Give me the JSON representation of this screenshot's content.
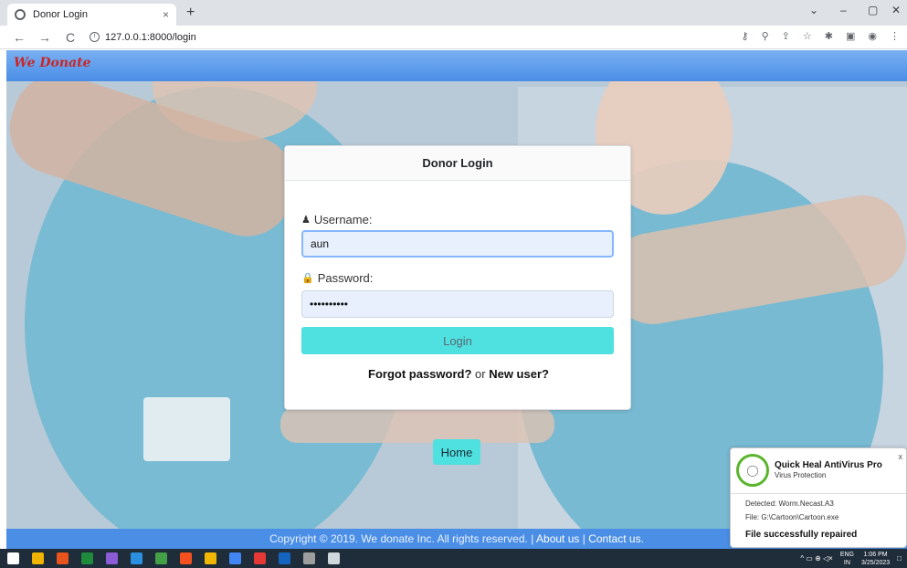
{
  "browser": {
    "tab_title": "Donor Login",
    "tab_close": "×",
    "new_tab": "+",
    "url": "127.0.0.1:8000/login",
    "nav": {
      "back": "←",
      "forward": "→",
      "reload": "C"
    },
    "window_controls": {
      "chevron": "⌄",
      "minimize": "–",
      "restore": "▢",
      "close": "✕"
    },
    "toolbar_icons": [
      "⚷",
      "⚲",
      "⇪",
      "☆",
      "✱",
      "▣",
      "◉",
      "⋮"
    ]
  },
  "navbar": {
    "brand": "We Donate"
  },
  "login": {
    "heading": "Donor Login",
    "username_label": "Username:",
    "username_value": "aun",
    "password_label": "Password:",
    "password_value": "••••••••••",
    "login_button": "Login",
    "forgot": "Forgot password?",
    "or": "or",
    "new_user": "New user?"
  },
  "home_button": "Home",
  "footer": {
    "copyright": "Copyright © 2019. We donate Inc. All rights reserved.",
    "sep": "|",
    "about": "About us",
    "contact": "Contact us."
  },
  "antivirus": {
    "title": "Quick Heal AntiVirus Pro",
    "subtitle": "Virus Protection",
    "detected": "Detected: Worm.Necast.A3",
    "file": "File: G:\\Cartoon\\Cartoon.exe",
    "status": "File successfully repaired",
    "close": "x"
  },
  "taskbar": {
    "lang": "ENG",
    "region": "IN",
    "time": "1:06 PM",
    "date": "3/25/2023",
    "tray_symbols": "^ ▭ ⊕ ◁×",
    "icon_colors": [
      "#ffffff",
      "#f0b400",
      "#e8541c",
      "#1e8a3c",
      "#8b5cd6",
      "#2b8fe0",
      "#43a047",
      "#f4511e",
      "#f2b705",
      "#4285f4",
      "#e53935",
      "#1565c0",
      "#9e9e9e",
      "#cfd8dc"
    ]
  },
  "colors": {
    "navbar": "#4a8ee6",
    "brand": "#c62828",
    "button": "#4fe0e0",
    "av_green": "#5ab52e"
  }
}
